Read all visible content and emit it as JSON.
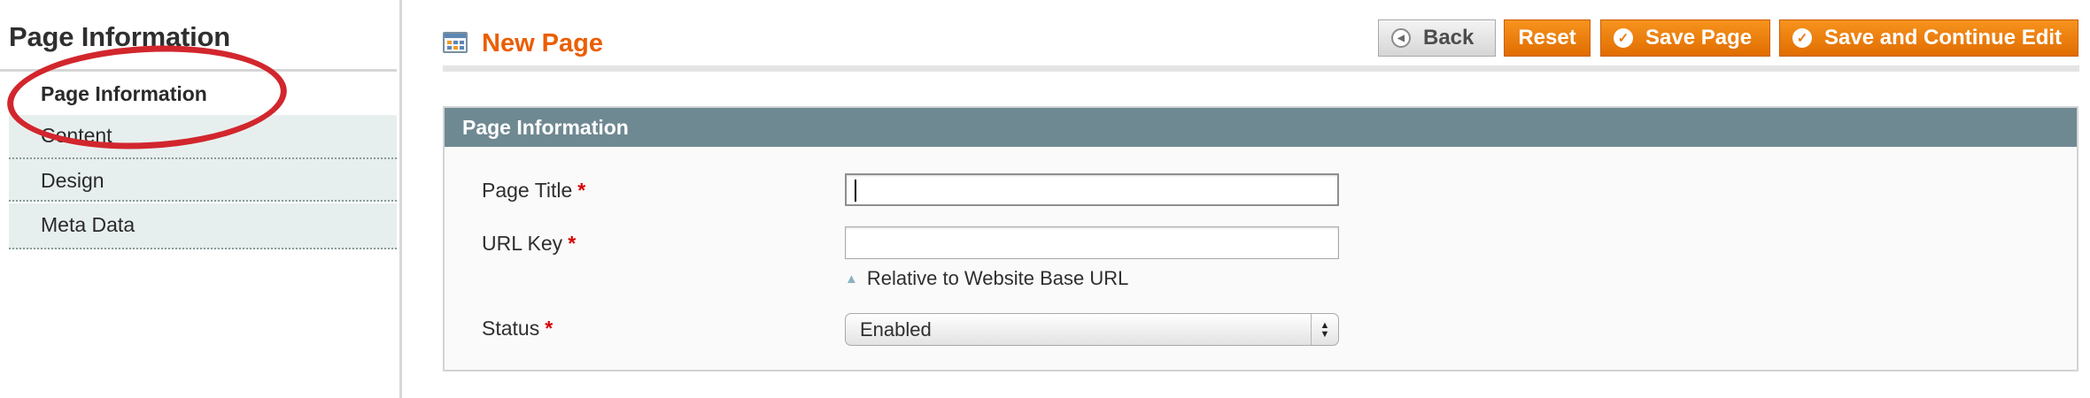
{
  "sidebar": {
    "title": "Page Information",
    "items": [
      {
        "label": "Page Information",
        "active": true
      },
      {
        "label": "Content"
      },
      {
        "label": "Design"
      },
      {
        "label": "Meta Data"
      }
    ]
  },
  "header": {
    "title": "New Page",
    "icon": "page-grid-icon",
    "buttons": {
      "back": "Back",
      "reset": "Reset",
      "save": "Save Page",
      "save_continue": "Save and Continue Edit"
    }
  },
  "form": {
    "legend": "Page Information",
    "required_mark": "*",
    "fields": {
      "page_title": {
        "label": "Page Title",
        "value": ""
      },
      "url_key": {
        "label": "URL Key",
        "value": "",
        "note": "Relative to Website Base URL"
      },
      "status": {
        "label": "Status",
        "selected": "Enabled"
      }
    }
  },
  "colors": {
    "accent": "#eb5e00",
    "button_orange": "#f28a1a",
    "fieldset_header": "#6f8992",
    "tab_bg": "#e7efee",
    "required": "#d80000",
    "annotation": "#d2262d"
  }
}
